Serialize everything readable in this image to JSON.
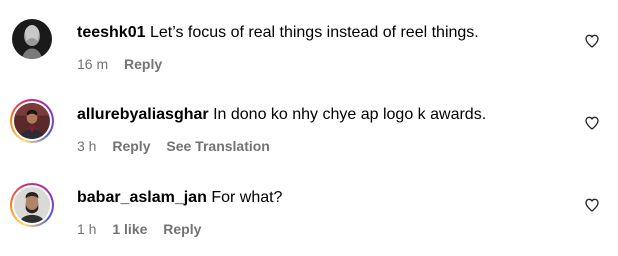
{
  "comments": [
    {
      "username": "teeshk01",
      "text": "Let’s focus of real things instead of reel things.",
      "time": "16 m",
      "likes": "",
      "reply_label": "Reply",
      "see_translation": ""
    },
    {
      "username": "allurebyaliasghar",
      "text": "In dono ko nhy chye ap logo k awards.",
      "time": "3 h",
      "likes": "",
      "reply_label": "Reply",
      "see_translation": "See Translation"
    },
    {
      "username": "babar_aslam_jan",
      "text": "For what?",
      "time": "1 h",
      "likes": "1 like",
      "reply_label": "Reply",
      "see_translation": ""
    }
  ],
  "colors": {
    "meta_text": "#737373",
    "story_ring": [
      "#feda75",
      "#fa7e1e",
      "#d62976",
      "#962fbf",
      "#4f5bd5"
    ]
  },
  "icons": {
    "like": "heart-outline-icon"
  }
}
